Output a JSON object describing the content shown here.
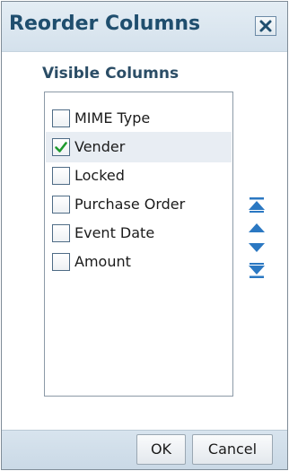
{
  "dialog": {
    "title": "Reorder Columns",
    "close_icon": "close-icon"
  },
  "section": {
    "label": "Visible Columns"
  },
  "columns": [
    {
      "label": "MIME Type",
      "checked": false,
      "selected": false
    },
    {
      "label": "Vender",
      "checked": true,
      "selected": true
    },
    {
      "label": "Locked",
      "checked": false,
      "selected": false
    },
    {
      "label": "Purchase Order",
      "checked": false,
      "selected": false
    },
    {
      "label": "Event Date",
      "checked": false,
      "selected": false
    },
    {
      "label": "Amount",
      "checked": false,
      "selected": false
    }
  ],
  "move_buttons": [
    {
      "icon": "move-to-top-icon"
    },
    {
      "icon": "move-up-icon"
    },
    {
      "icon": "move-down-icon"
    },
    {
      "icon": "move-to-bottom-icon"
    }
  ],
  "buttons": {
    "ok_label": "OK",
    "cancel_label": "Cancel"
  },
  "colors": {
    "title_text": "#1f4e6e",
    "titlebar_bg": "#d9e5ef",
    "selected_row_bg": "#e8edf3",
    "checkmark": "#1e9a2e",
    "arrow_icon": "#2b78c2",
    "footer_bg": "#cfdde9"
  }
}
